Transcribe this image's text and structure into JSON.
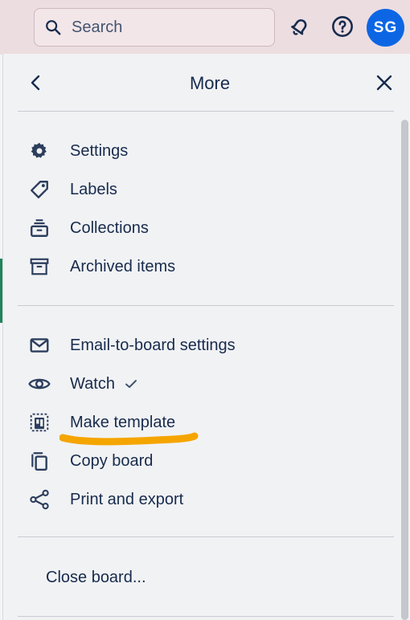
{
  "search": {
    "placeholder": "Search"
  },
  "header": {
    "avatar_initials": "SG"
  },
  "panel": {
    "title": "More",
    "groups": [
      {
        "items": [
          {
            "label": "Settings",
            "icon": "gear-icon"
          },
          {
            "label": "Labels",
            "icon": "tag-icon"
          },
          {
            "label": "Collections",
            "icon": "collections-icon"
          },
          {
            "label": "Archived items",
            "icon": "archive-icon"
          }
        ]
      },
      {
        "items": [
          {
            "label": "Email-to-board settings",
            "icon": "envelope-icon"
          },
          {
            "label": "Watch",
            "icon": "eye-icon",
            "checked": true
          },
          {
            "label": "Make template",
            "icon": "template-icon",
            "annotation": "orange-underline"
          },
          {
            "label": "Copy board",
            "icon": "copy-icon"
          },
          {
            "label": "Print and export",
            "icon": "share-icon"
          }
        ]
      },
      {
        "items": [
          {
            "label": "Close board..."
          }
        ]
      }
    ]
  },
  "colors": {
    "accent": "#0c66e4",
    "highlight": "#f5a500",
    "text": "#172b4d"
  }
}
